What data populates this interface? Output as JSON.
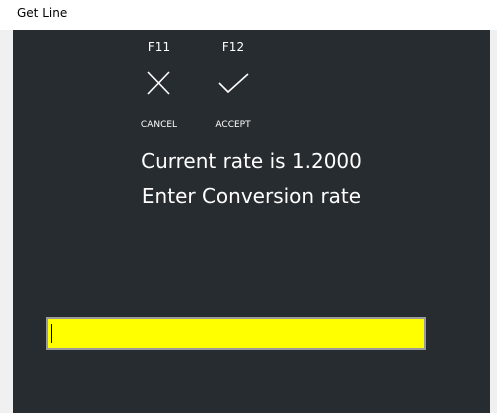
{
  "window": {
    "title": "Get Line"
  },
  "function_keys": [
    {
      "key": "F11",
      "label": "CANCEL",
      "icon": "close-icon"
    },
    {
      "key": "F12",
      "label": "ACCEPT",
      "icon": "check-icon"
    }
  ],
  "prompt": {
    "line1": "Current rate is 1.2000",
    "line2": "Enter Conversion rate"
  },
  "input": {
    "value": ""
  },
  "colors": {
    "background": "#272c31",
    "input_background": "#ffff00",
    "text": "#ffffff"
  }
}
